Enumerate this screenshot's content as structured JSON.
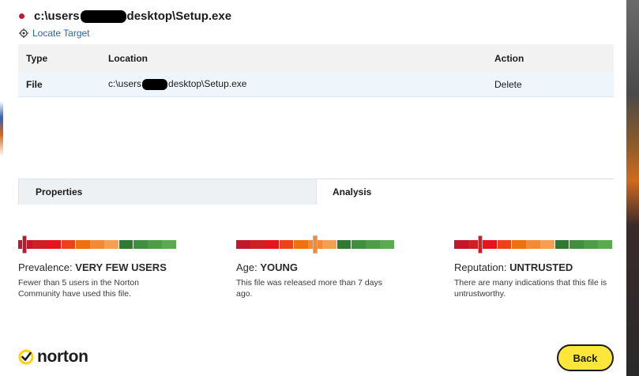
{
  "header": {
    "title_prefix": "c:\\users",
    "title_suffix": "desktop\\Setup.exe",
    "status_color": "#c01c2a"
  },
  "locate": {
    "label": "Locate Target",
    "icon": "crosshair-icon"
  },
  "table": {
    "headers": [
      "Type",
      "Location",
      "Action"
    ],
    "rows": [
      {
        "type": "File",
        "location_prefix": "c:\\users",
        "location_suffix": "desktop\\Setup.exe",
        "action": "Delete"
      }
    ]
  },
  "tabs": [
    {
      "label": "Properties",
      "active": false
    },
    {
      "label": "Analysis",
      "active": true
    }
  ],
  "scale_colors": [
    "#c0182a",
    "#cf1f24",
    "#e8141d",
    "#f0401a",
    "#f1700e",
    "#f38a35",
    "#f5a050",
    "#2f7a30",
    "#3f8f3f",
    "#4c9d45",
    "#5aab50"
  ],
  "metrics": [
    {
      "name": "Prevalence:",
      "value": "VERY FEW USERS",
      "description": "Fewer than 5 users in the Norton Community have used this file.",
      "level": 0.04
    },
    {
      "name": "Age:",
      "value": "YOUNG",
      "description": "This file was released more than 7 days ago.",
      "level": 0.49
    },
    {
      "name": "Reputation:",
      "value": "UNTRUSTED",
      "description": "There are many indications that this file is untrustworthy.",
      "level": 0.16
    }
  ],
  "footer": {
    "brand": "norton",
    "brand_icon": "norton-check-icon",
    "brand_color": "#fdd400",
    "back_label": "Back",
    "back_color": "#fde63a"
  }
}
